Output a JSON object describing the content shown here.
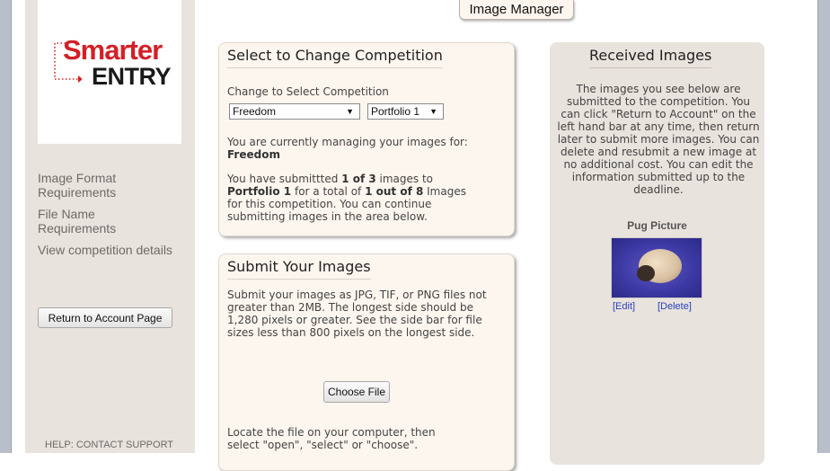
{
  "header": {
    "title": "Image Manager"
  },
  "logo": {
    "word1": "Smarter",
    "word2": "ENTRY"
  },
  "sidebar": {
    "links": [
      {
        "label": "Image Format Requirements"
      },
      {
        "label": "File Name Requirements"
      },
      {
        "label": "View competition details"
      }
    ],
    "return_button": "Return to Account Page",
    "help": "HELP: CONTACT SUPPORT"
  },
  "competition_panel": {
    "heading": "Select to Change Competition",
    "select_label": "Change to Select Competition",
    "competition_selected": "Freedom",
    "portfolio_selected": "Portfolio 1",
    "managing_text": "You are currently managing your images for:",
    "managing_name": "Freedom",
    "status": {
      "t1": "You have submittted ",
      "b1": "1 of 3",
      "t2": " images to",
      "b2": "Portfolio 1",
      "t3": " for a total of ",
      "b3": "1 out of 8",
      "t4": " Images",
      "t5": "for this competition. You can continue",
      "t6": "submitting images in the area below."
    }
  },
  "submit_panel": {
    "heading": "Submit Your Images",
    "instructions": "Submit your images as JPG, TIF, or PNG files not greater than 2MB. The longest side should be 1,280 pixels or greater. See the side bar for file sizes less than 800 pixels on the longest side.",
    "choose_file": "Choose File",
    "locate_text": "Locate the file on your computer, then select \"open\", \"select\" or \"choose\"."
  },
  "received_panel": {
    "heading": "Received Images",
    "description": "The images you see below are submitted to the competition. You can click \"Return to Account\" on the left hand bar at any time, then return later to submit more images. You can delete and resubmit a new image at no additional cost. You can edit the information submitted up to the deadline.",
    "image_title": "Pug Picture",
    "edit_label": "[Edit]",
    "delete_label": "[Delete]"
  },
  "colors": {
    "brand_red": "#d32027",
    "panel_bg": "#fdf6ef",
    "sidebar_bg": "#e8e3dd",
    "link_blue": "#2a3fbf"
  },
  "icons": {
    "logo_arrow": "dotted-arrow-icon",
    "dropdown": "triangle-down-icon"
  }
}
